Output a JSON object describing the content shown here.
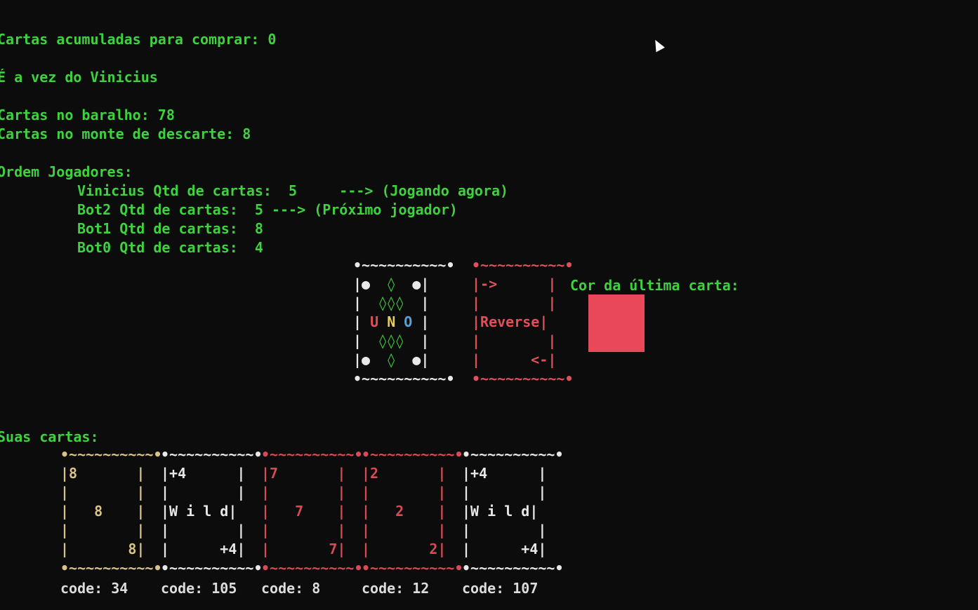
{
  "status": {
    "accumulated": "Cartas acumuladas para comprar: 0",
    "turn": "É a vez do Vinicius",
    "deck": "Cartas no baralho: 78",
    "discard": "Cartas no monte de descarte: 8",
    "order_title": "Ordem Jogadores:"
  },
  "players": [
    {
      "line": "Vinicius Qtd de cartas:  5     ---> (Jogando agora)"
    },
    {
      "line": "Bot2 Qtd de cartas:  5 ---> (Próximo jogador)"
    },
    {
      "line": "Bot1 Qtd de cartas:  8"
    },
    {
      "line": "Bot0 Qtd de cartas:  4"
    }
  ],
  "table": {
    "deck_card": {
      "border": "•~~~~~~~~~~•",
      "rows": [
        "|●  ◊  ●|",
        "|  ◊◊◊  |",
        "| U N O |",
        "|  ◊◊◊  |",
        "|●  ◊  ●|"
      ],
      "colors": {
        "frame": "#e8e8e8",
        "u": "#e0505a",
        "n": "#e6d060",
        "o": "#5aa0d0",
        "diamond": "#3fd13f"
      }
    },
    "top_card": {
      "border": "•~~~~~~~~~~•",
      "rows": [
        "|->      |",
        "|        |",
        "|Reverse|",
        "|        |",
        "|      <-|"
      ],
      "color": "#e0505a"
    },
    "last_color_label": "Cor da última carta:",
    "last_color": "#e8485a"
  },
  "hand": {
    "title": "Suas cartas:",
    "cards": [
      {
        "top": "|8       |",
        "mid": "|   8    |",
        "bot": "|       8|",
        "code": "code: 34",
        "color": "#d8c48a"
      },
      {
        "top": "|+4      |",
        "mid": "|W i l d|",
        "bot": "|      +4|",
        "code": "code: 105",
        "color": "#e8e8e8"
      },
      {
        "top": "|7       |",
        "mid": "|   7    |",
        "bot": "|       7|",
        "code": "code: 8",
        "color": "#d84a55"
      },
      {
        "top": "|2       |",
        "mid": "|   2    |",
        "bot": "|       2|",
        "code": "code: 12",
        "color": "#d84a55"
      },
      {
        "top": "|+4      |",
        "mid": "|W i l d|",
        "bot": "|      +4|",
        "code": "code: 107",
        "color": "#e8e8e8"
      }
    ]
  }
}
